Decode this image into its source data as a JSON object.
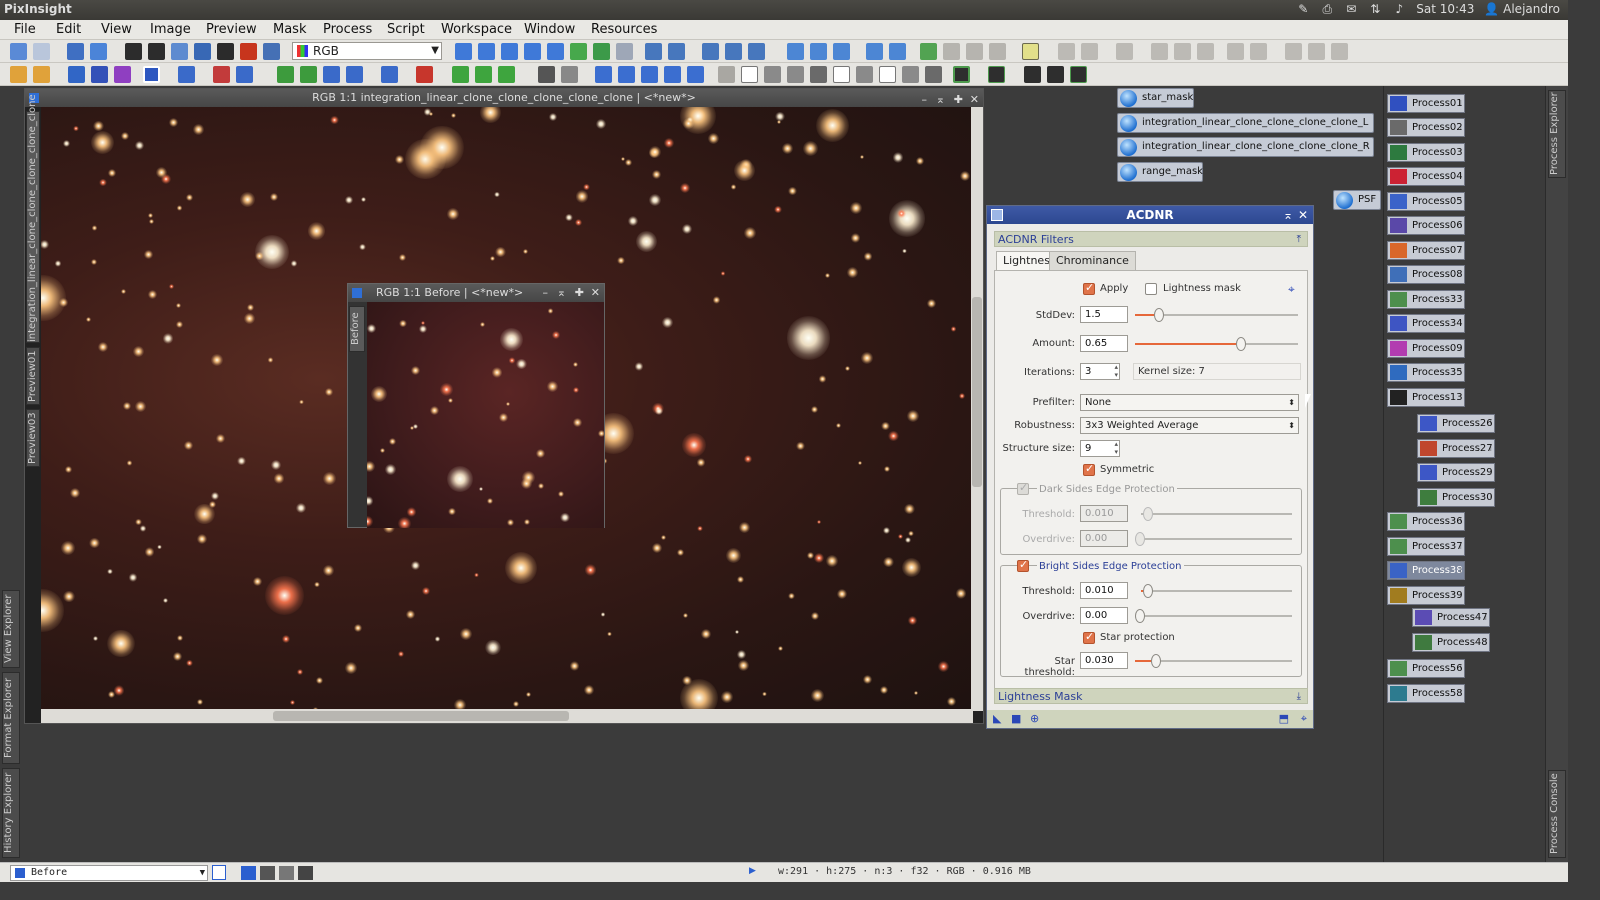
{
  "os": {
    "app_name": "PixInsight",
    "clock": "Sat 10:43",
    "user": "Alejandro"
  },
  "menu": [
    "File",
    "Edit",
    "View",
    "Image",
    "Preview",
    "Mask",
    "Process",
    "Script",
    "Workspace",
    "Window",
    "Resources"
  ],
  "toolbar": {
    "channel_select": "RGB"
  },
  "main_window": {
    "title": "RGB 1:1 integration_linear_clone_clone_clone_clone_clone | <*new*>",
    "side_tabs": [
      "integration_linear_clone_clone_clone_clone_clone",
      "Preview01",
      "Preview03"
    ]
  },
  "before_window": {
    "title": "RGB 1:1 Before | <*new*>",
    "side_tab": "Before"
  },
  "left_rail": [
    "View Explorer",
    "Format Explorer",
    "History Explorer"
  ],
  "right_rail": [
    "Process Explorer",
    "Process Console"
  ],
  "image_icons": [
    "star_mask",
    "integration_linear_clone_clone_clone_clone_L",
    "integration_linear_clone_clone_clone_clone_R",
    "range_mask",
    "PSF"
  ],
  "process_icons": [
    "Process01",
    "Process02",
    "Process03",
    "Process04",
    "Process05",
    "Process06",
    "Process07",
    "Process08",
    "Process33",
    "Process34",
    "Process09",
    "Process35",
    "Process13",
    "Process26",
    "Process27",
    "Process29",
    "Process30",
    "Process36",
    "Process37",
    "Process38",
    "Process39",
    "Process47",
    "Process48",
    "Process56",
    "Process58"
  ],
  "acdnr": {
    "title": "ACDNR",
    "section_filters": "ACDNR Filters",
    "tabs": [
      "Lightness",
      "Chrominance"
    ],
    "apply_label": "Apply",
    "lightness_mask_label": "Lightness mask",
    "stddev_label": "StdDev:",
    "stddev_value": "1.5",
    "stddev_level": 0.15,
    "amount_label": "Amount:",
    "amount_value": "0.65",
    "amount_level": 0.65,
    "iterations_label": "Iterations:",
    "iterations_value": "3",
    "kernel_size": "Kernel size: 7",
    "prefilter_label": "Prefilter:",
    "prefilter_value": "None",
    "robustness_label": "Robustness:",
    "robustness_value": "3x3 Weighted Average",
    "structure_label": "Structure size:",
    "structure_value": "9",
    "symmetric_label": "Symmetric",
    "dark_group": "Dark Sides Edge Protection",
    "dark_threshold_label": "Threshold:",
    "dark_threshold_value": "0.010",
    "dark_overdrive_label": "Overdrive:",
    "dark_overdrive_value": "0.00",
    "bright_group": "Bright Sides Edge Protection",
    "bright_threshold_label": "Threshold:",
    "bright_threshold_value": "0.010",
    "bright_overdrive_label": "Overdrive:",
    "bright_overdrive_value": "0.00",
    "star_protection_label": "Star protection",
    "star_threshold_label": "Star threshold:",
    "star_threshold_value": "0.030",
    "section_mask": "Lightness Mask"
  },
  "status": {
    "view_selected": "Before",
    "info": "w:291 · h:275 · n:3 · f32 · RGB · 0.916 MB"
  }
}
